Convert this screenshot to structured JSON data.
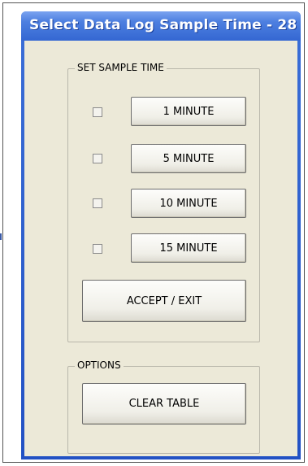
{
  "window": {
    "title": "Select Data Log Sample Time - 28"
  },
  "sample_group": {
    "legend": "SET SAMPLE TIME",
    "options": [
      {
        "label": "1 MINUTE",
        "checked": false
      },
      {
        "label": "5 MINUTE",
        "checked": false
      },
      {
        "label": "10 MINUTE",
        "checked": false
      },
      {
        "label": "15 MINUTE",
        "checked": false
      }
    ],
    "accept_label": "ACCEPT / EXIT"
  },
  "options_group": {
    "legend": "OPTIONS",
    "clear_label": "CLEAR TABLE"
  }
}
